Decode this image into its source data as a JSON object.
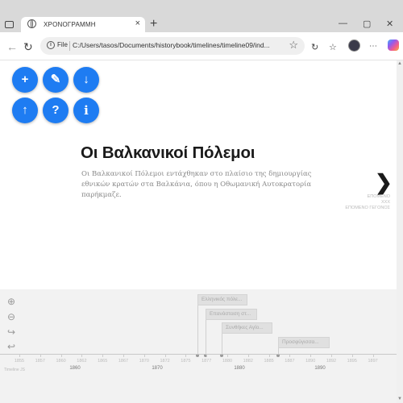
{
  "browser": {
    "tab_title": "ΧΡΟΝΟΓΡΑΜΜΗ",
    "tab_close": "×",
    "new_tab": "+",
    "window_controls": [
      "—",
      "▢",
      "✕"
    ],
    "file_label": "File",
    "url": "C:/Users/tasos/Documents/historybook/timelines/timeline09/ind...",
    "info_icon": "i",
    "star_icon": "☆",
    "back_icon": "←",
    "reload_icon": "↻",
    "toolbar_icons": [
      "↻",
      "☆",
      "⧉"
    ]
  },
  "fab_buttons": [
    {
      "icon": "plus-icon",
      "glyph": "+"
    },
    {
      "icon": "pencil-icon",
      "glyph": "✎"
    },
    {
      "icon": "arrow-down-icon",
      "glyph": "↓"
    },
    {
      "icon": "arrow-up-icon",
      "glyph": "↑"
    },
    {
      "icon": "question-icon",
      "glyph": "?"
    },
    {
      "icon": "info-icon",
      "glyph": "i"
    }
  ],
  "slide": {
    "headline": "Οι Βαλκανικοί Πόλεμοι",
    "description": "Οι Βαλκανικοί Πόλεμοι εντάχθηκαν στο πλαίσιο της δημιουργίας εθνικών κρατών στα Βαλκάνια, όπου η Οθωμανική Αυτοκρατορία παρήκμαζε.",
    "next_arrow": "❯",
    "next_meta": [
      "ΕΠΟΜΕΝΟ",
      "ΧΧΧ",
      "ΕΠΟΜΕΝΟ ΓΕΓΟΝΟΣ"
    ]
  },
  "timenav": {
    "zoom_icons": [
      {
        "name": "zoom-in-icon",
        "glyph": "⊕"
      },
      {
        "name": "zoom-out-icon",
        "glyph": "⊖"
      },
      {
        "name": "redo-icon",
        "glyph": "↪"
      },
      {
        "name": "undo-icon",
        "glyph": "↩"
      }
    ],
    "markers": [
      "Ελληνικός πόλε...",
      "Επανάσταση στ...",
      "Συνθήκες Αγίο...",
      "Προσφύγισσα..."
    ],
    "minor_labels": [
      "1855",
      "1857",
      "1860",
      "1862",
      "1865",
      "1867",
      "1870",
      "1872",
      "1875",
      "1877",
      "1880",
      "1882",
      "1885",
      "1887",
      "1890",
      "1892",
      "1895",
      "1897"
    ],
    "major_labels": [
      "1860",
      "1870",
      "1880",
      "1890"
    ],
    "credit": "Timeline JS"
  },
  "scrollbar": {
    "up": "▲",
    "down": "▼"
  }
}
